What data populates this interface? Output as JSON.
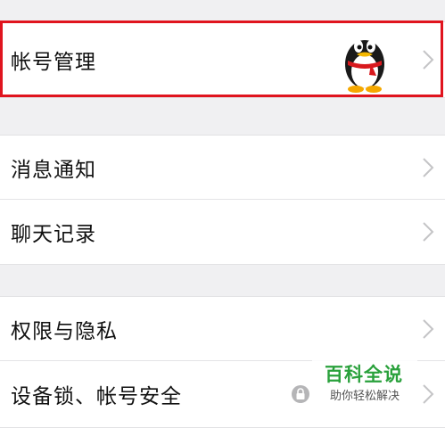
{
  "settings": {
    "items": [
      {
        "label": "帐号管理"
      },
      {
        "label": "消息通知"
      },
      {
        "label": "聊天记录"
      },
      {
        "label": "权限与隐私"
      },
      {
        "label": "设备锁、帐号安全"
      }
    ]
  },
  "watermark": {
    "title": "百科全说",
    "subtitle": "助你轻松解决"
  },
  "colors": {
    "highlight": "#e0141e",
    "watermark_green": "#2aa13c",
    "background": "#f0f0f2"
  }
}
